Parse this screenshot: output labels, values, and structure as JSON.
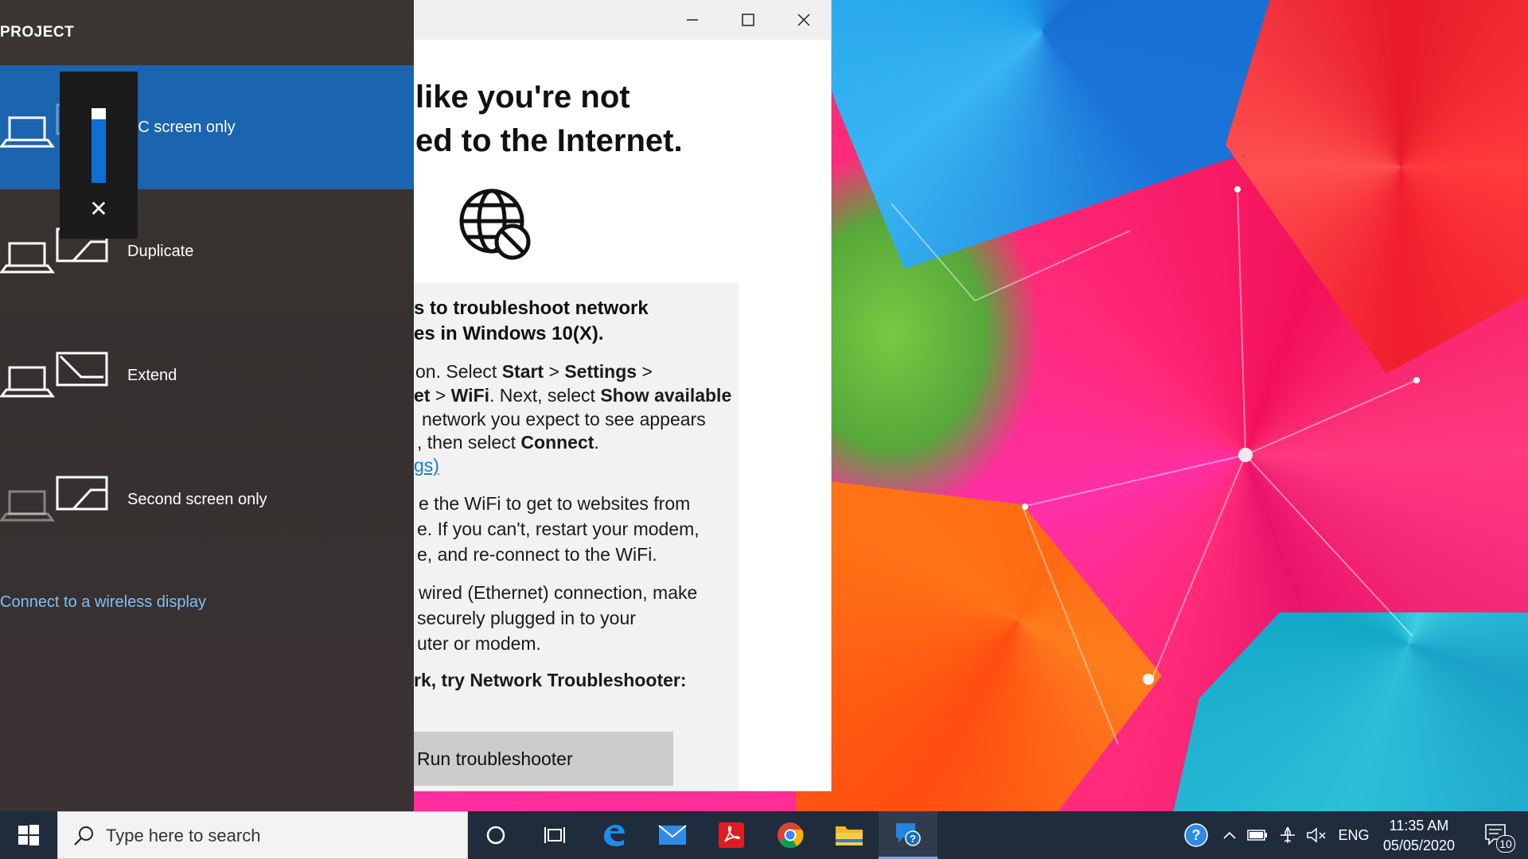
{
  "project": {
    "title": "PROJECT",
    "options": [
      {
        "label": "PC screen only",
        "selected": true
      },
      {
        "label": "Duplicate",
        "selected": false
      },
      {
        "label": "Extend",
        "selected": false
      },
      {
        "label": "Second screen only",
        "selected": false
      }
    ],
    "connect_link": "Connect to a wireless display"
  },
  "volume": {
    "level": 0.85
  },
  "window": {
    "headline_line1": "like you're not",
    "headline_line2": "ed to the Internet.",
    "section_title_line1": "s to troubleshoot network",
    "section_title_line2": "es in Windows 10(X).",
    "para1": [
      {
        "prefix": "on. Select ",
        "b1": "Start",
        "mid1": " > ",
        "b2": "Settings",
        "mid2": " >",
        "b3": "",
        "suffix": ""
      },
      {
        "prefix": "",
        "b1": "et",
        "mid1": " > ",
        "b2": "WiFi",
        "mid2": ". Next, select ",
        "b3": "Show available",
        "suffix": ""
      },
      {
        "prefix": "network you expect to see appears",
        "b1": "",
        "mid1": "",
        "b2": "",
        "mid2": "",
        "b3": "",
        "suffix": ""
      },
      {
        "prefix": ", then select ",
        "b1": "Connect",
        "mid1": ".",
        "b2": "",
        "mid2": "",
        "b3": "",
        "suffix": ""
      }
    ],
    "link_fragment": "gs)",
    "para2": [
      "e the WiFi to get to websites from",
      "e. If you can't, restart your modem,",
      "e, and re-connect to the WiFi."
    ],
    "para3": [
      "wired (Ethernet) connection, make",
      "securely plugged in to your",
      "uter or modem."
    ],
    "para4": "rk, try Network Troubleshooter:",
    "button_label": "Run troubleshooter"
  },
  "taskbar": {
    "search_placeholder": "Type here to search",
    "language": "ENG",
    "time": "11:35 AM",
    "date": "05/05/2020",
    "notification_count": "10"
  }
}
